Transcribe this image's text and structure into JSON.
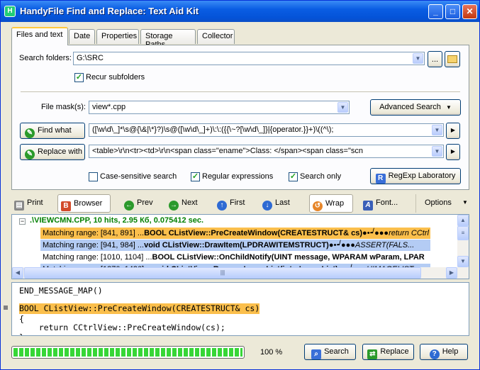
{
  "window": {
    "title": "HandyFile Find and Replace: Text Aid Kit",
    "min": "_",
    "max": "□",
    "close": "✕",
    "app_icon": "H"
  },
  "tabs": [
    "Files and text",
    "Date",
    "Properties",
    "Storage Paths",
    "Collector"
  ],
  "form": {
    "search_folders_label": "Search folders:",
    "search_folders_value": "G:\\SRC",
    "browse_label": "...",
    "recur_label": "Recur subfolders",
    "recur_checked": true,
    "file_mask_label": "File mask(s):",
    "file_mask_value": "view*.cpp",
    "advanced_label": "Advanced Search",
    "find_what_label": "Find what",
    "find_what_value": "([\\w\\d\\_]*\\s@{\\&|\\*}?)\\s@([\\w\\d\\_]+)\\:\\:({{\\~?[\\w\\d\\_]}|{operator.}}+)\\((^\\);",
    "replace_with_label": "Replace with",
    "replace_with_value": "<table>\\r\\n<tr><td>\\r\\n<span class=\"ename\">Class: </span><span class=\"scn",
    "case_sensitive_label": "Case-sensitive search",
    "case_sensitive_checked": false,
    "regex_label": "Regular expressions",
    "regex_checked": true,
    "search_only_label": "Search only",
    "search_only_checked": true,
    "regexp_lab_label": "RegExp Laboratory"
  },
  "toolbar": {
    "print": "Print",
    "browser": "Browser",
    "prev": "Prev",
    "next": "Next",
    "first": "First",
    "last": "Last",
    "wrap": "Wrap",
    "font": "Font...",
    "options": "Options"
  },
  "results": {
    "file_line": ".\\VIEWCMN.CPP, 10 hits, 2.95 Кб, 0.075412 sec.",
    "rows": [
      {
        "range": "Matching range: [841, 891] ...",
        "code": "BOOL CListView::PreCreateWindow(CREATESTRUCT& cs)",
        "tail": "●•┙●●●return CCtrl"
      },
      {
        "range": "Matching range: [941, 984] ...",
        "code": "void CListView::DrawItem(LPDRAWITEMSTRUCT)",
        "tail": "●•┙●●●ASSERT(FALS..."
      },
      {
        "range": "Matching range: [1010, 1104] ...",
        "code": "BOOL CListView::OnChildNotify(UINT message, WPARAM wParam, LPAR",
        "tail": ""
      },
      {
        "range": "Matching range: [1270, 1426] ...",
        "code": "void CListView::RemoveImageList(int nImageList)",
        "tail": "●•  ┙●●●HIMAGELIST"
      }
    ]
  },
  "editor": {
    "lines": [
      "END_MESSAGE_MAP()",
      "",
      "BOOL CListView::PreCreateWindow(CREATESTRUCT& cs)",
      "{",
      "    return CCtrlView::PreCreateWindow(cs);",
      "}"
    ]
  },
  "status": {
    "progress_percent": 100,
    "progress_text": "100 %",
    "search": "Search",
    "replace": "Replace",
    "help": "Help"
  },
  "colors": {
    "title_bar": "#0a5de3",
    "highlight_orange": "#fbbf4c",
    "highlight_blue": "#b4ccf4",
    "file_green": "#007f00",
    "accent_yellow": "#ffc83c"
  }
}
